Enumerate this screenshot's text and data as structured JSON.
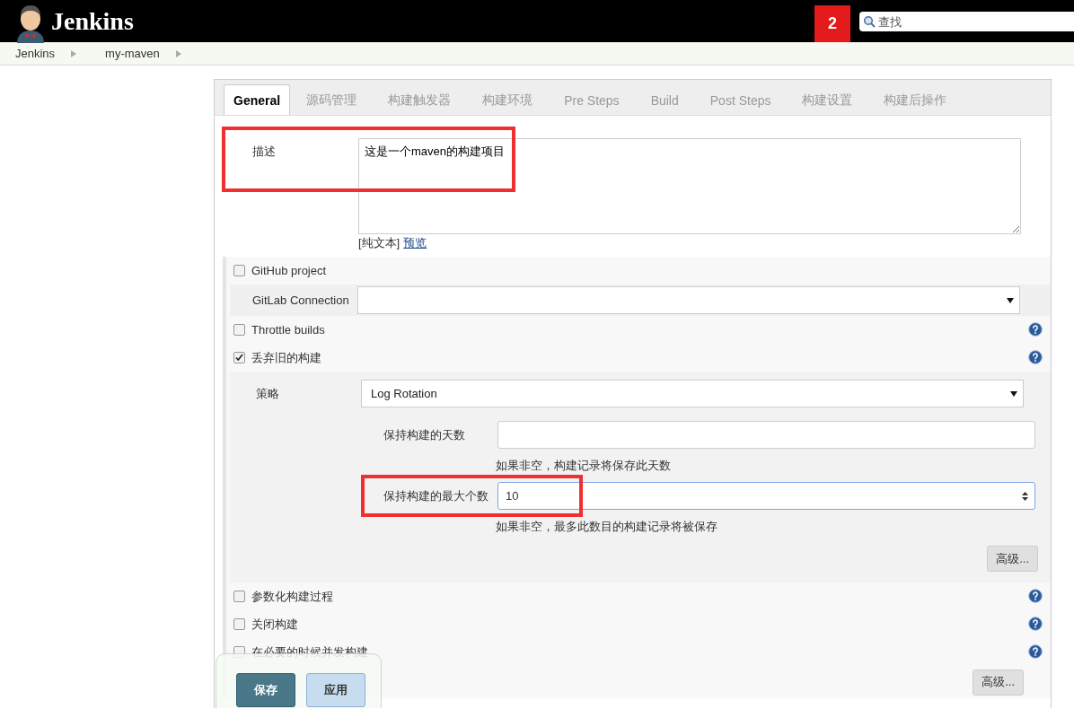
{
  "header": {
    "title": "Jenkins",
    "badge": "2",
    "search": {
      "placeholder": "查找"
    }
  },
  "breadcrumbs": [
    "Jenkins",
    "my-maven"
  ],
  "tabs": [
    {
      "label": "General",
      "selected": true
    },
    {
      "label": "源码管理",
      "selected": false
    },
    {
      "label": "构建触发器",
      "selected": false
    },
    {
      "label": "构建环境",
      "selected": false
    },
    {
      "label": "Pre Steps",
      "selected": false
    },
    {
      "label": "Build",
      "selected": false
    },
    {
      "label": "Post Steps",
      "selected": false
    },
    {
      "label": "构建设置",
      "selected": false
    },
    {
      "label": "构建后操作",
      "selected": false
    }
  ],
  "description": {
    "label": "描述",
    "value": "这是一个maven的构建项目",
    "format": "[纯文本]",
    "preview_link": "预览",
    "highlighted": true
  },
  "options": [
    {
      "kind": "checkbox",
      "label": "GitHub project",
      "checked": false,
      "help": false
    },
    {
      "kind": "select",
      "label": "GitLab Connection"
    },
    {
      "kind": "checkbox",
      "label": "Throttle builds",
      "checked": false,
      "help": true
    },
    {
      "kind": "checkbox",
      "label": "丢弃旧的构建",
      "checked": true,
      "help": true,
      "details": {
        "strategy": {
          "label": "策略",
          "value": "Log Rotation"
        },
        "fields": [
          {
            "label": "保持构建的天数",
            "hint": "如果非空，构建记录将保存此天数",
            "highlighted": false,
            "spinner": false
          },
          {
            "label": "保持构建的最大个数",
            "value": "10",
            "hint": "如果非空，最多此数目的构建记录将被保存",
            "highlighted": true,
            "spinner": true
          }
        ],
        "advanced_button": "高级..."
      }
    },
    {
      "kind": "checkbox",
      "label": "参数化构建过程",
      "checked": false,
      "help": true
    },
    {
      "kind": "checkbox",
      "label": "关闭构建",
      "checked": false,
      "help": true
    },
    {
      "kind": "checkbox",
      "label": "在必要的时候并发构建",
      "checked": false,
      "help": true
    }
  ],
  "advanced_button": "高级...",
  "save_bar": {
    "save_button": "保存",
    "apply_button": "应用"
  }
}
